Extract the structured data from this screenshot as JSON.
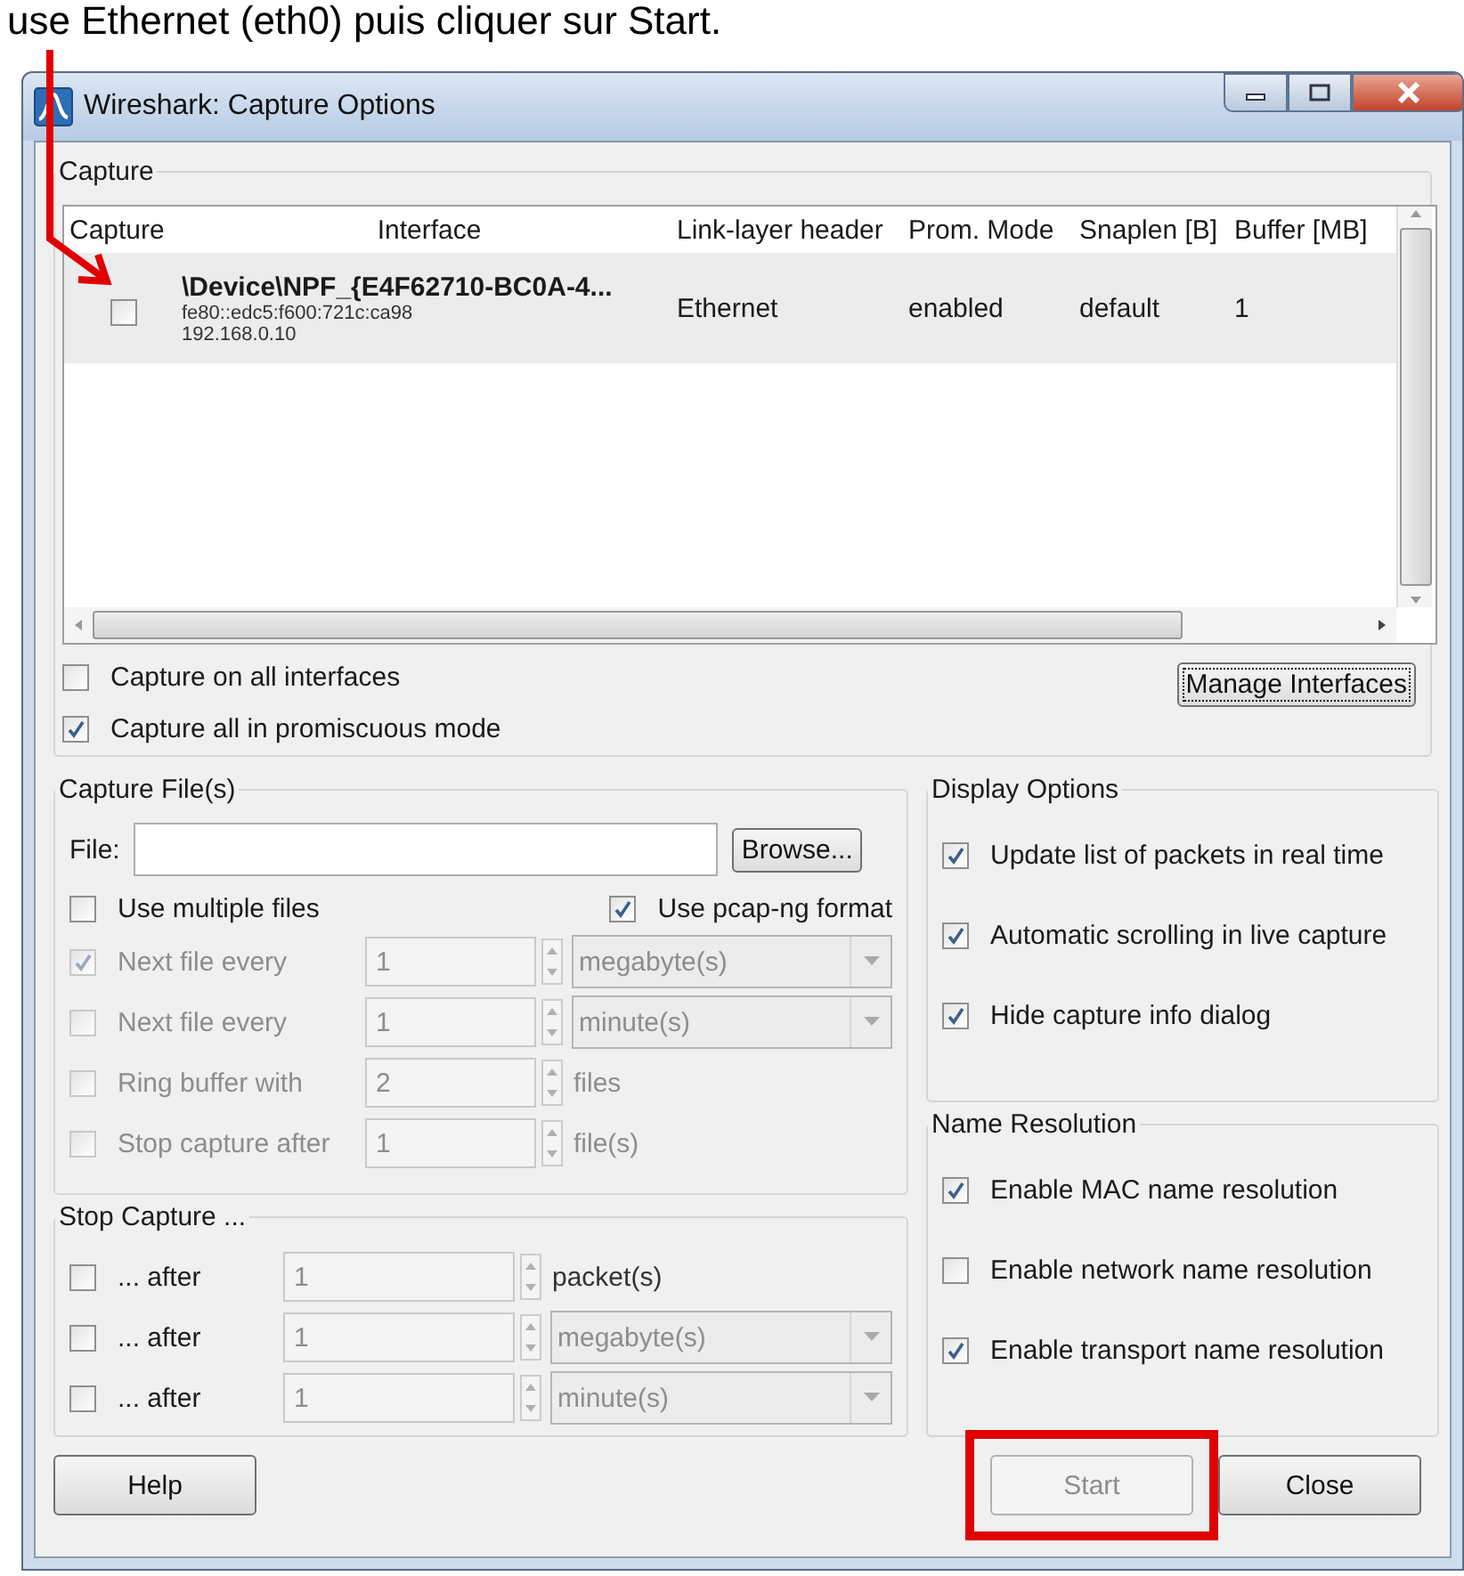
{
  "annotation": {
    "text": "use Ethernet (eth0) puis cliquer sur Start."
  },
  "window": {
    "title": "Wireshark: Capture Options"
  },
  "capture": {
    "title": "Capture",
    "columns": [
      "Capture",
      "Interface",
      "Link-layer header",
      "Prom. Mode",
      "Snaplen [B]",
      "Buffer [MB]"
    ],
    "rows": [
      {
        "checked": false,
        "interface": "\\Device\\NPF_{E4F62710-BC0A-4...",
        "address": "fe80::edc5:f600:721c:ca98",
        "ip": "192.168.0.10",
        "link_layer": "Ethernet",
        "prom_mode": "enabled",
        "snaplen": "default",
        "buffer": "1"
      }
    ],
    "options": [
      {
        "label": "Capture on all interfaces",
        "checked": false
      },
      {
        "label": "Capture all in promiscuous mode",
        "checked": true
      }
    ],
    "manage_button": "Manage Interfaces"
  },
  "capture_files": {
    "title": "Capture File(s)",
    "file_label": "File:",
    "browse_button": "Browse...",
    "multiple_files": {
      "label": "Use multiple files",
      "checked": false
    },
    "pcapng": {
      "label": "Use pcap-ng format",
      "checked": true
    },
    "rows": [
      {
        "kind": "dropdown",
        "label": "Next file every",
        "checked": true,
        "disabled": true,
        "value": "1",
        "unit": "megabyte(s)"
      },
      {
        "kind": "dropdown",
        "label": "Next file every",
        "checked": false,
        "disabled": true,
        "value": "1",
        "unit": "minute(s)"
      },
      {
        "kind": "text",
        "label": "Ring buffer with",
        "checked": false,
        "disabled": true,
        "value": "2",
        "unit": "files"
      },
      {
        "kind": "text",
        "label": "Stop capture after",
        "checked": false,
        "disabled": true,
        "value": "1",
        "unit": "file(s)"
      }
    ]
  },
  "stop_capture": {
    "title": "Stop Capture ...",
    "rows": [
      {
        "kind": "text",
        "label": "... after",
        "checked": false,
        "disabled": false,
        "value": "1",
        "unit": "packet(s)"
      },
      {
        "kind": "dropdown",
        "label": "... after",
        "checked": false,
        "disabled": false,
        "value": "1",
        "unit": "megabyte(s)"
      },
      {
        "kind": "dropdown",
        "label": "... after",
        "checked": false,
        "disabled": false,
        "value": "1",
        "unit": "minute(s)"
      }
    ]
  },
  "display_options": {
    "title": "Display Options",
    "options": [
      {
        "label": "Update list of packets in real time",
        "checked": true
      },
      {
        "label": "Automatic scrolling in live capture",
        "checked": true
      },
      {
        "label": "Hide capture info dialog",
        "checked": true
      }
    ]
  },
  "name_resolution": {
    "title": "Name Resolution",
    "options": [
      {
        "label": "Enable MAC name resolution",
        "checked": true
      },
      {
        "label": "Enable network name resolution",
        "checked": false
      },
      {
        "label": "Enable transport name resolution",
        "checked": true
      }
    ]
  },
  "buttons": [
    {
      "label": "Help",
      "disabled": false,
      "highlighted": false
    },
    {
      "label": "Start",
      "disabled": true,
      "highlighted": true
    },
    {
      "label": "Close",
      "disabled": false,
      "highlighted": false
    }
  ]
}
